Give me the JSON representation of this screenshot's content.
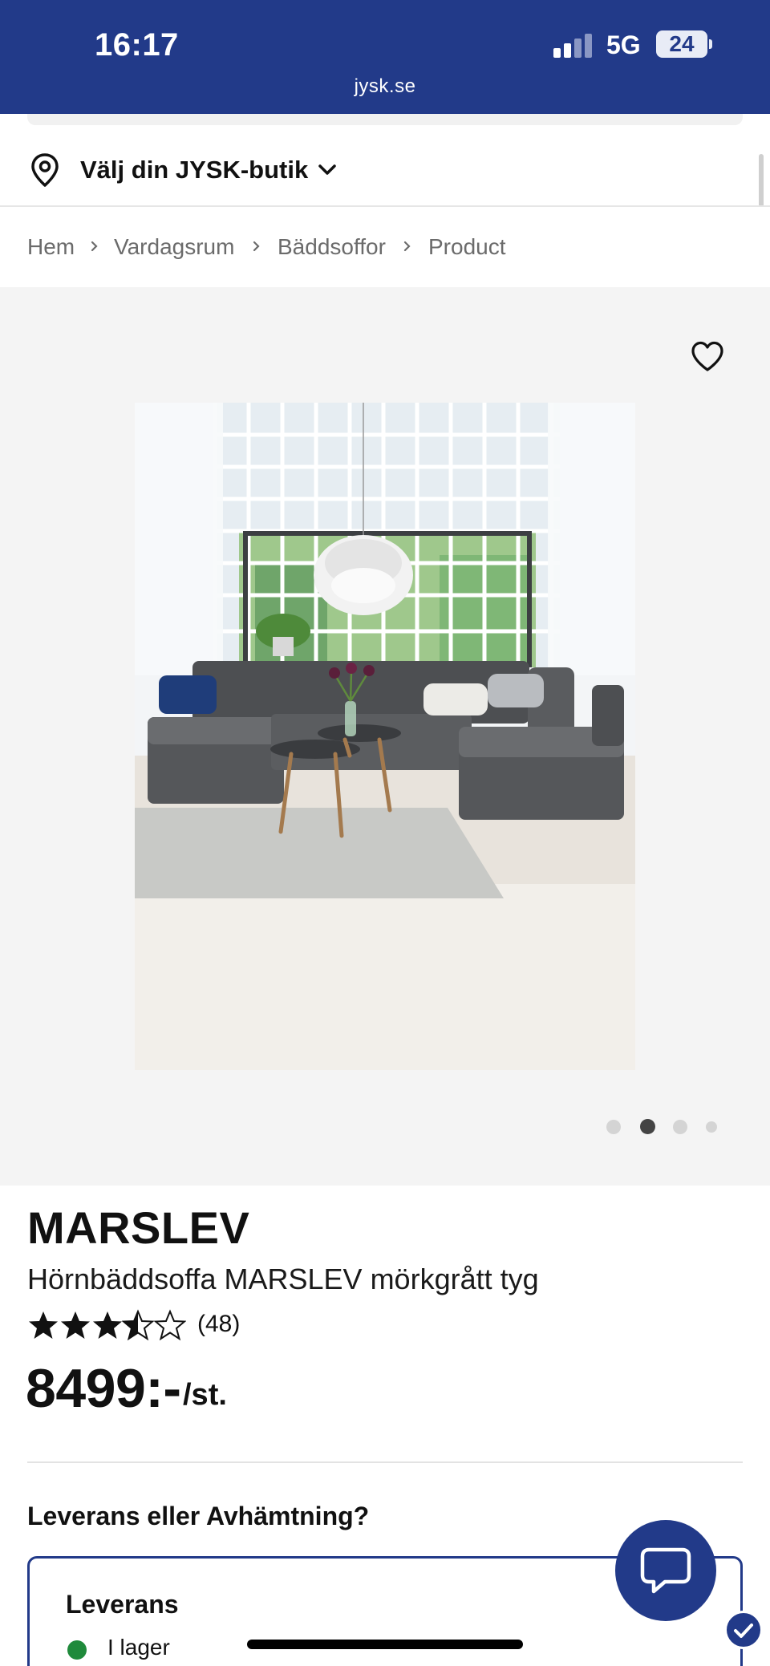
{
  "status_bar": {
    "time": "16:17",
    "network": "5G",
    "battery": "24",
    "url": "jysk.se"
  },
  "store_selector": {
    "label": "Välj din JYSK-butik",
    "icon": "location-pin-icon"
  },
  "breadcrumb": [
    "Hem",
    "Vardagsrum",
    "Bäddsoffor",
    "Product"
  ],
  "gallery": {
    "image_count": 4,
    "active_index": 1
  },
  "product": {
    "name": "MARSLEV",
    "description": "Hörnbäddsoffa MARSLEV mörkgrått tyg",
    "rating": 3.5,
    "rating_max": 5,
    "reviews": "(48)",
    "price": "8499:-",
    "unit": "/st."
  },
  "delivery": {
    "question": "Leverans eller Avhämtning?",
    "title": "Leverans",
    "stock_status": "I lager",
    "stock_color": "#1f8a3b"
  },
  "colors": {
    "brand": "#223a89"
  }
}
